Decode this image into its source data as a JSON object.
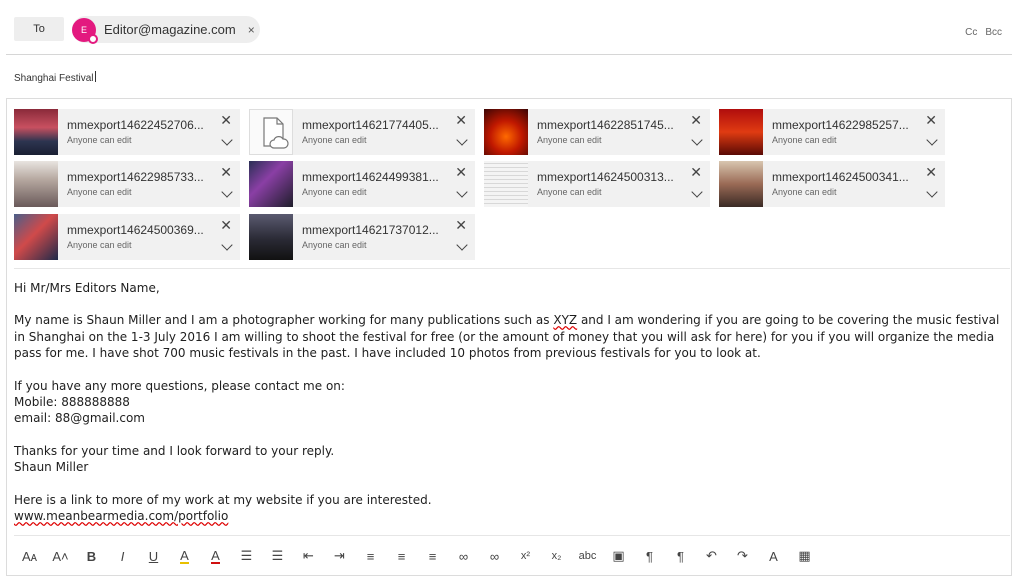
{
  "header": {
    "to_label": "To",
    "recipient": {
      "avatar_letter": "E",
      "email": "Editor@magazine.com",
      "remove_glyph": "×"
    },
    "cc_label": "Cc",
    "bcc_label": "Bcc"
  },
  "subject": {
    "value": "Shanghai Festival"
  },
  "attachments": {
    "remove_glyph": "✕",
    "items": [
      {
        "name": "mmexport14622452706...",
        "permission": "Anyone can edit",
        "thumb": "crowd-photo"
      },
      {
        "name": "mmexport14621774405...",
        "permission": "Anyone can edit",
        "thumb": "cloud-file-icon"
      },
      {
        "name": "mmexport14622851745...",
        "permission": "Anyone can edit",
        "thumb": "stage-photo"
      },
      {
        "name": "mmexport14622985257...",
        "permission": "Anyone can edit",
        "thumb": "poster-photo"
      },
      {
        "name": "mmexport14622985733...",
        "permission": "Anyone can edit",
        "thumb": "crowd-photo"
      },
      {
        "name": "mmexport14624499381...",
        "permission": "Anyone can edit",
        "thumb": "collage-photo"
      },
      {
        "name": "mmexport14624500313...",
        "permission": "Anyone can edit",
        "thumb": "document-photo"
      },
      {
        "name": "mmexport14624500341...",
        "permission": "Anyone can edit",
        "thumb": "crowd-photo"
      },
      {
        "name": "mmexport14624500369...",
        "permission": "Anyone can edit",
        "thumb": "collage-photo"
      },
      {
        "name": "mmexport14621737012...",
        "permission": "Anyone can edit",
        "thumb": "stage-photo"
      }
    ]
  },
  "message": {
    "greeting": "Hi Mr/Mrs Editors Name,",
    "p1_a": "My name is Shaun Miller and I am a photographer working for many publications such as ",
    "p1_flagged": "XYZ",
    "p1_b": " and  I am wondering if you are going to be covering the music festival in Shanghai on the 1-3 July 2016 I am willing to shoot the festival for free (or the amount of money that you will ask for here)  for you if you will organize the media pass for me. I have shot 700 music festivals in the past. I have included 10 photos from previous festivals for you to look at.",
    "contact_intro": "If you have any more questions, please contact me on:",
    "mobile": "Mobile:  888888888",
    "email": "email:    88@gmail.com",
    "thanks": "Thanks for your time and I look forward to your reply.",
    "signature": "Shaun Miller",
    "link_intro": "Here is a link to more of my work at my website if you are interested.",
    "link": "www.meanbearmedia.com/portfolio"
  },
  "toolbar": {
    "items": [
      {
        "name": "font-size-icon",
        "glyph": "Aᴀ"
      },
      {
        "name": "grow-font-icon",
        "glyph": "A˄"
      },
      {
        "name": "bold-icon",
        "glyph": "B"
      },
      {
        "name": "italic-icon",
        "glyph": "I"
      },
      {
        "name": "underline-icon",
        "glyph": "U"
      },
      {
        "name": "highlight-icon",
        "glyph": "A"
      },
      {
        "name": "font-color-icon",
        "glyph": "A"
      },
      {
        "name": "bullets-icon",
        "glyph": "☰"
      },
      {
        "name": "numbering-icon",
        "glyph": "☰"
      },
      {
        "name": "decrease-indent-icon",
        "glyph": "⇤"
      },
      {
        "name": "increase-indent-icon",
        "glyph": "⇥"
      },
      {
        "name": "align-left-icon",
        "glyph": "≡"
      },
      {
        "name": "align-center-icon",
        "glyph": "≡"
      },
      {
        "name": "align-right-icon",
        "glyph": "≡"
      },
      {
        "name": "insert-link-icon",
        "glyph": "∞"
      },
      {
        "name": "remove-link-icon",
        "glyph": "∞"
      },
      {
        "name": "superscript-icon",
        "glyph": "x²"
      },
      {
        "name": "subscript-icon",
        "glyph": "x₂"
      },
      {
        "name": "strikethrough-icon",
        "glyph": "abc"
      },
      {
        "name": "insert-picture-icon",
        "glyph": "▣"
      },
      {
        "name": "left-to-right-icon",
        "glyph": "¶"
      },
      {
        "name": "right-to-left-icon",
        "glyph": "¶"
      },
      {
        "name": "undo-icon",
        "glyph": "↶"
      },
      {
        "name": "redo-icon",
        "glyph": "↷"
      },
      {
        "name": "clear-formatting-icon",
        "glyph": "A"
      },
      {
        "name": "insert-table-icon",
        "glyph": "▦"
      }
    ]
  }
}
